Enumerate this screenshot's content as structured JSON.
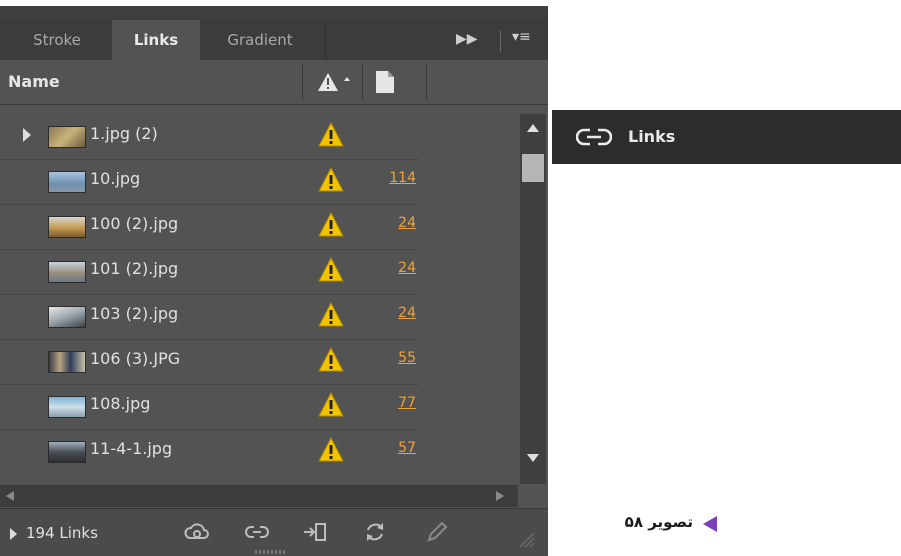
{
  "panel": {
    "tabs": [
      {
        "label": "Stroke"
      },
      {
        "label": "Links"
      },
      {
        "label": "Gradient"
      }
    ],
    "header": {
      "name_label": "Name"
    },
    "rows": [
      {
        "name": "1.jpg (2)",
        "page": "",
        "expandable": true
      },
      {
        "name": "10.jpg",
        "page": "114",
        "expandable": false
      },
      {
        "name": "100 (2).jpg",
        "page": "24",
        "expandable": false
      },
      {
        "name": "101 (2).jpg",
        "page": "24",
        "expandable": false
      },
      {
        "name": "103 (2).jpg",
        "page": "24",
        "expandable": false
      },
      {
        "name": "106 (3).JPG",
        "page": "55",
        "expandable": false
      },
      {
        "name": "108.jpg",
        "page": "77",
        "expandable": false
      },
      {
        "name": "11-4-1.jpg",
        "page": "57",
        "expandable": false
      }
    ],
    "footer": {
      "count_label": "194 Links"
    }
  },
  "flyout": {
    "label": "Links"
  },
  "caption": {
    "text": "تصویر ۵۸"
  },
  "colors": {
    "panel_bg": "#535353",
    "page_link": "#f0a23a",
    "warning": "#f2c300",
    "caption_arrow": "#7b3fb8"
  },
  "icons": {
    "warning": "warning-icon",
    "link": "link-icon",
    "relink": "relink-icon",
    "cloud": "cloud-icon",
    "goto": "goto-link-icon",
    "update": "update-icon",
    "edit": "edit-original-icon"
  }
}
